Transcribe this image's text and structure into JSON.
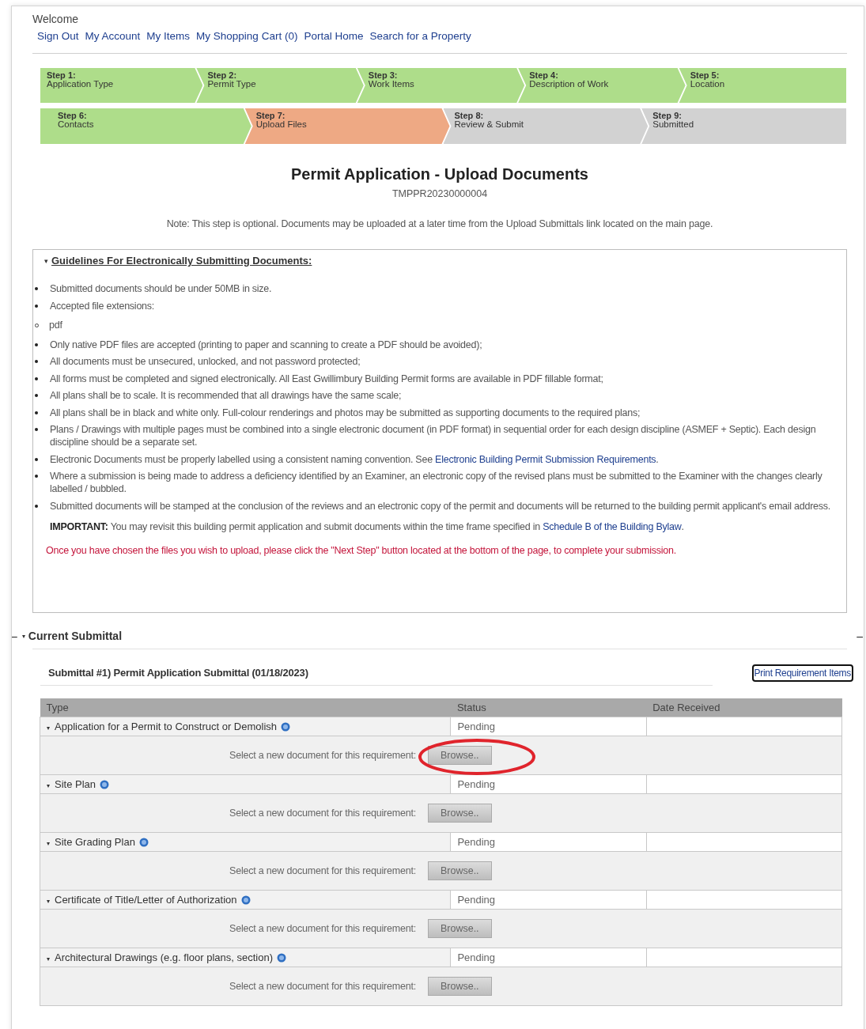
{
  "header": {
    "welcome": "Welcome",
    "links": [
      "Sign Out",
      "My Account",
      "My Items",
      "My Shopping Cart (0)",
      "Portal Home",
      "Search for a Property"
    ]
  },
  "step_rows": [
    [
      {
        "step": "Step 1:",
        "label": "Application Type",
        "completed": true,
        "selected": false
      },
      {
        "step": "Step 2:",
        "label": "Permit Type",
        "completed": true,
        "selected": false
      },
      {
        "step": "Step 3:",
        "label": "Work Items",
        "completed": true,
        "selected": false
      },
      {
        "step": "Step 4:",
        "label": "Description of Work",
        "completed": true,
        "selected": false
      },
      {
        "step": "Step 5:",
        "label": "Location",
        "completed": true,
        "selected": false
      }
    ],
    [
      {
        "step": "Step 6:",
        "label": "Contacts",
        "completed": true,
        "selected": false
      },
      {
        "step": "Step 7:",
        "label": "Upload Files",
        "completed": false,
        "selected": true
      },
      {
        "step": "Step 8:",
        "label": "Review & Submit",
        "completed": false,
        "selected": false
      },
      {
        "step": "Step 9:",
        "label": "Submitted",
        "completed": false,
        "selected": false
      }
    ]
  ],
  "page_title": "Permit Application - Upload Documents",
  "record_id": "TMPPR20230000004",
  "note": "Note: This step is optional. Documents may be uploaded at a later time from the Upload Submittals link located on the main page.",
  "guidelines": {
    "toggle": "▾",
    "title": "Guidelines For Electronically Submitting Documents:",
    "items": [
      {
        "kind": "bullet",
        "text": "Submitted documents should be under 50MB in size."
      },
      {
        "kind": "bullet",
        "text": "Accepted file extensions:"
      },
      {
        "kind": "sub",
        "text": "pdf"
      },
      {
        "kind": "bullet",
        "text": "Only native PDF files are accepted (printing to paper and scanning to create a PDF should be avoided);"
      },
      {
        "kind": "bullet",
        "text": "All documents must be unsecured, unlocked, and not password protected;"
      },
      {
        "kind": "bullet",
        "text": "All forms must be completed and signed electronically. All East Gwillimbury Building Permit forms are available in PDF fillable format;"
      },
      {
        "kind": "bullet",
        "text": "All plans shall be to scale. It is recommended that all drawings have the same scale;"
      },
      {
        "kind": "bullet",
        "text": "All plans shall be in black and white only. Full-colour renderings and photos may be submitted as supporting documents to the required plans;"
      },
      {
        "kind": "bullet",
        "text": "Plans / Drawings with multiple pages must be combined into a single electronic document (in PDF format) in sequential order for each design discipline (ASMEF + Septic). Each design discipline should be a separate set."
      },
      {
        "kind": "bullet",
        "text": "Electronic Documents must be properly labelled using a consistent naming convention. See ",
        "link": "Electronic Building Permit Submission Requirements",
        "after": "."
      },
      {
        "kind": "bullet",
        "text": "Where a submission is being made to address a deficiency identified by an Examiner, an electronic copy of the revised plans must be submitted to the Examiner with the changes clearly labelled / bubbled."
      },
      {
        "kind": "bullet",
        "text": "Submitted documents will be stamped at the conclusion of the reviews and an electronic copy of the permit and documents will be returned to the building permit applicant's email address."
      }
    ],
    "important": {
      "text": "**IMPORTANT:** You may revisit this building permit application and submit documents within the time frame specified in ",
      "link": "Schedule B of the Building Bylaw",
      "after": "."
    },
    "warning": "Once you have chosen the files you wish to upload, please click the \"Next Step\" button located at the bottom of the page, to complete your submission."
  },
  "current_submittal": {
    "collapse_left": "–",
    "toggle": "▾",
    "title": "Current Submittal",
    "collapse_right": "–",
    "submittal_title": "Submittal #1) Permit Application Submittal (01/18/2023)",
    "print_button": "Print Requirement Items",
    "columns": [
      "Type",
      "Status",
      "Date Received"
    ],
    "requirements": [
      {
        "toggle": "▾",
        "name": "Application for a Permit to Construct or Demolish",
        "status": "Pending",
        "prompt": "Select a new document for this requirement:",
        "button": "Browse..",
        "highlighted": true
      },
      {
        "toggle": "▾",
        "name": "Site Plan",
        "status": "Pending",
        "prompt": "Select a new document for this requirement:",
        "button": "Browse..",
        "highlighted": false
      },
      {
        "toggle": "▾",
        "name": "Site Grading Plan",
        "status": "Pending",
        "prompt": "Select a new document for this requirement:",
        "button": "Browse..",
        "highlighted": false
      },
      {
        "toggle": "▾",
        "name": "Certificate of Title/Letter of Authorization",
        "status": "Pending",
        "prompt": "Select a new document for this requirement:",
        "button": "Browse..",
        "highlighted": false
      },
      {
        "toggle": "▾",
        "name": "Architectural Drawings (e.g. floor plans, section)",
        "status": "Pending",
        "prompt": "Select a new document for this requirement:",
        "button": "Browse..",
        "highlighted": false
      }
    ]
  }
}
